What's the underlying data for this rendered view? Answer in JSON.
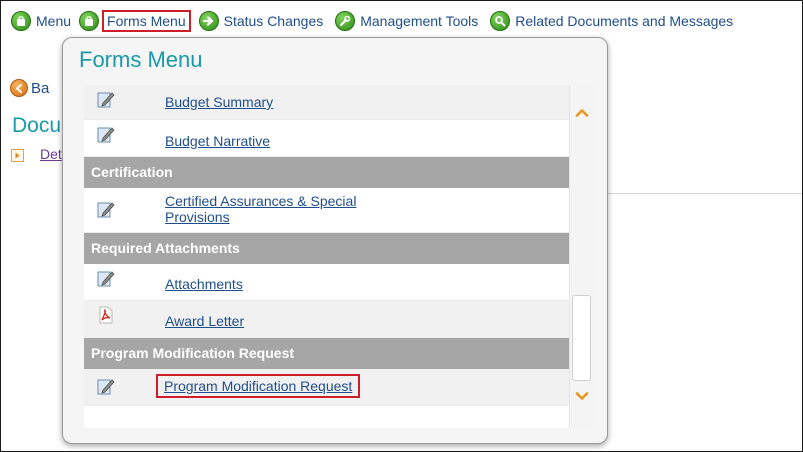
{
  "topnav": {
    "items": [
      {
        "label": "Menu",
        "icon": "menu-icon"
      },
      {
        "label": "Forms Menu",
        "icon": "forms-menu-icon"
      },
      {
        "label": "Status Changes",
        "icon": "status-changes-icon"
      },
      {
        "label": "Management Tools",
        "icon": "management-tools-icon"
      },
      {
        "label": "Related Documents and Messages",
        "icon": "related-documents-icon"
      }
    ]
  },
  "background": {
    "back_label": "Ba",
    "heading": "Docu",
    "details_link": "Det"
  },
  "popup": {
    "title": "Forms Menu",
    "rows": {
      "budget_summary": "Budget Summary",
      "budget_narrative": "Budget Narrative",
      "certification_header": "Certification",
      "certified_line1": "Certified Assurances & Special",
      "certified_line2": "Provisions",
      "attachments_header": "Required Attachments",
      "attachments": "Attachments",
      "award_letter": "Award Letter",
      "pmr_header": "Program Modification Request",
      "pmr_link": "Program Modification Request"
    }
  },
  "colors": {
    "accent_teal": "#1a9aa8",
    "link_blue": "#1f4e8c",
    "section_gray": "#a6a6a6",
    "highlight_red": "#cc1f2a",
    "scroll_arrow_orange": "#e8961e"
  }
}
